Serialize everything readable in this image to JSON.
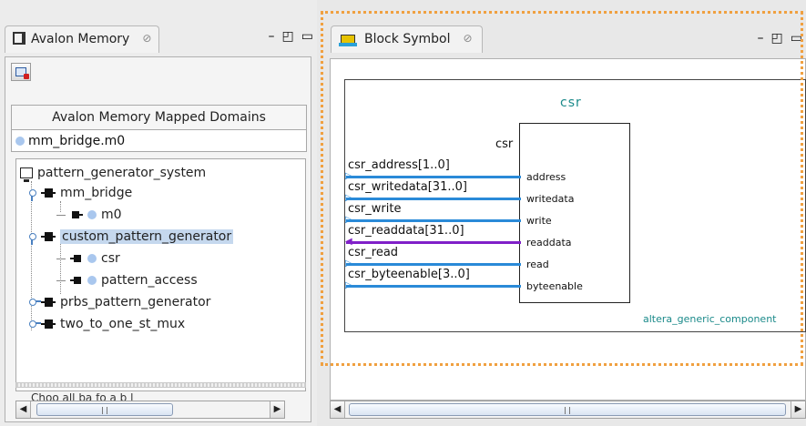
{
  "left": {
    "tab_label": "Avalon Memory",
    "tab_close": "⊘",
    "window_controls": [
      "–",
      "◰",
      "▭"
    ],
    "domains_header": "Avalon Memory Mapped Domains",
    "domain_item": "mm_bridge.m0",
    "tree": [
      {
        "label": "pattern_generator_system"
      },
      {
        "label": "mm_bridge"
      },
      {
        "label": "m0"
      },
      {
        "label": "custom_pattern_generator"
      },
      {
        "label": "csr"
      },
      {
        "label": "pattern_access"
      },
      {
        "label": "prbs_pattern_generator"
      },
      {
        "label": "two_to_one_st_mux"
      }
    ],
    "hidden_text": "Choo all ba  fo  a  b  l"
  },
  "right": {
    "tab_label": "Block Symbol",
    "tab_close": "⊘",
    "window_controls": [
      "–",
      "◰",
      "▭"
    ],
    "diagram": {
      "title": "csr",
      "block_label": "csr",
      "signals": [
        "csr_address[1..0]",
        "csr_writedata[31..0]",
        "csr_write",
        "csr_readdata[31..0]",
        "csr_read",
        "csr_byteenable[3..0]"
      ],
      "ports": [
        "address",
        "writedata",
        "write",
        "readdata",
        "read",
        "byteenable"
      ],
      "vendor": "altera_generic_component",
      "readdata_color": "#8020c8",
      "wire_color": "#2a8ad8"
    }
  },
  "scroll_arrows": {
    "left": "◀",
    "right": "▶"
  }
}
